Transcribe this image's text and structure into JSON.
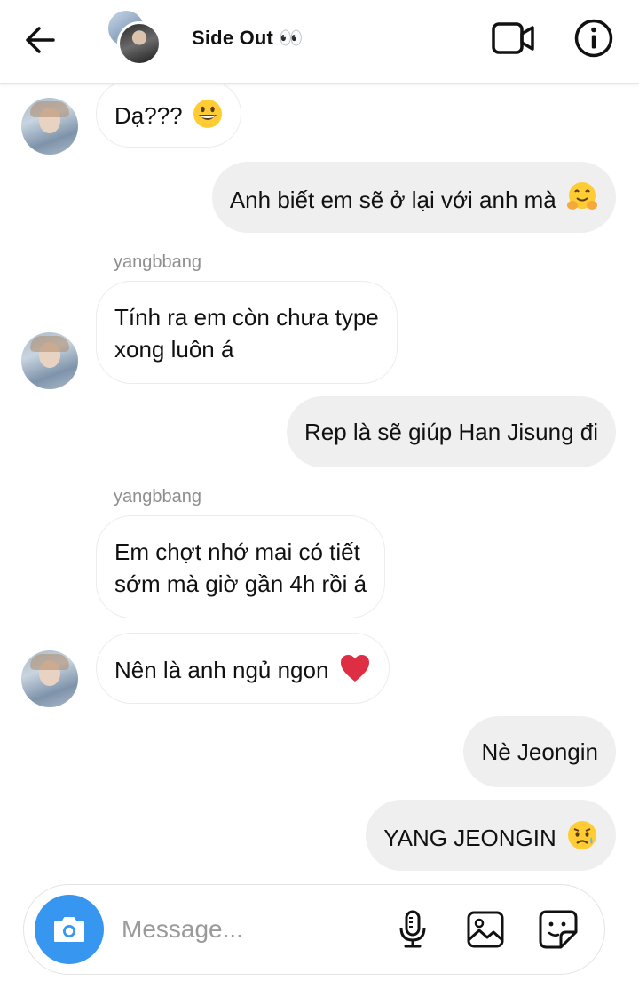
{
  "header": {
    "back_icon": "arrow-left-icon",
    "title": "Side Out 👀",
    "video_icon": "video-camera-icon",
    "info_icon": "info-icon"
  },
  "messages": [
    {
      "direction": "incoming",
      "sender": "",
      "text": "Dạ??? 😃"
    },
    {
      "direction": "outgoing",
      "text": "Anh biết em sẽ ở lại với anh mà 🤗"
    },
    {
      "direction": "incoming",
      "sender": "yangbbang",
      "text_lines": [
        "Tính ra em còn chưa type",
        "xong luôn á"
      ]
    },
    {
      "direction": "outgoing",
      "text": "Rep là sẽ giúp Han Jisung đi"
    },
    {
      "direction": "incoming",
      "sender": "yangbbang",
      "text_lines": [
        "Em chợt nhớ mai có tiết",
        "sớm mà giờ gần 4h rồi á"
      ]
    },
    {
      "direction": "incoming",
      "sender": "",
      "text": "Nên là anh ngủ ngon ❤️"
    },
    {
      "direction": "outgoing",
      "text": "Nè Jeongin"
    },
    {
      "direction": "outgoing",
      "text": "YANG JEONGIN 😥"
    }
  ],
  "composer": {
    "placeholder": "Message...",
    "camera_icon": "camera-icon",
    "mic_icon": "microphone-icon",
    "gallery_icon": "image-icon",
    "sticker_icon": "sticker-icon",
    "accent_color": "#3797f0"
  }
}
